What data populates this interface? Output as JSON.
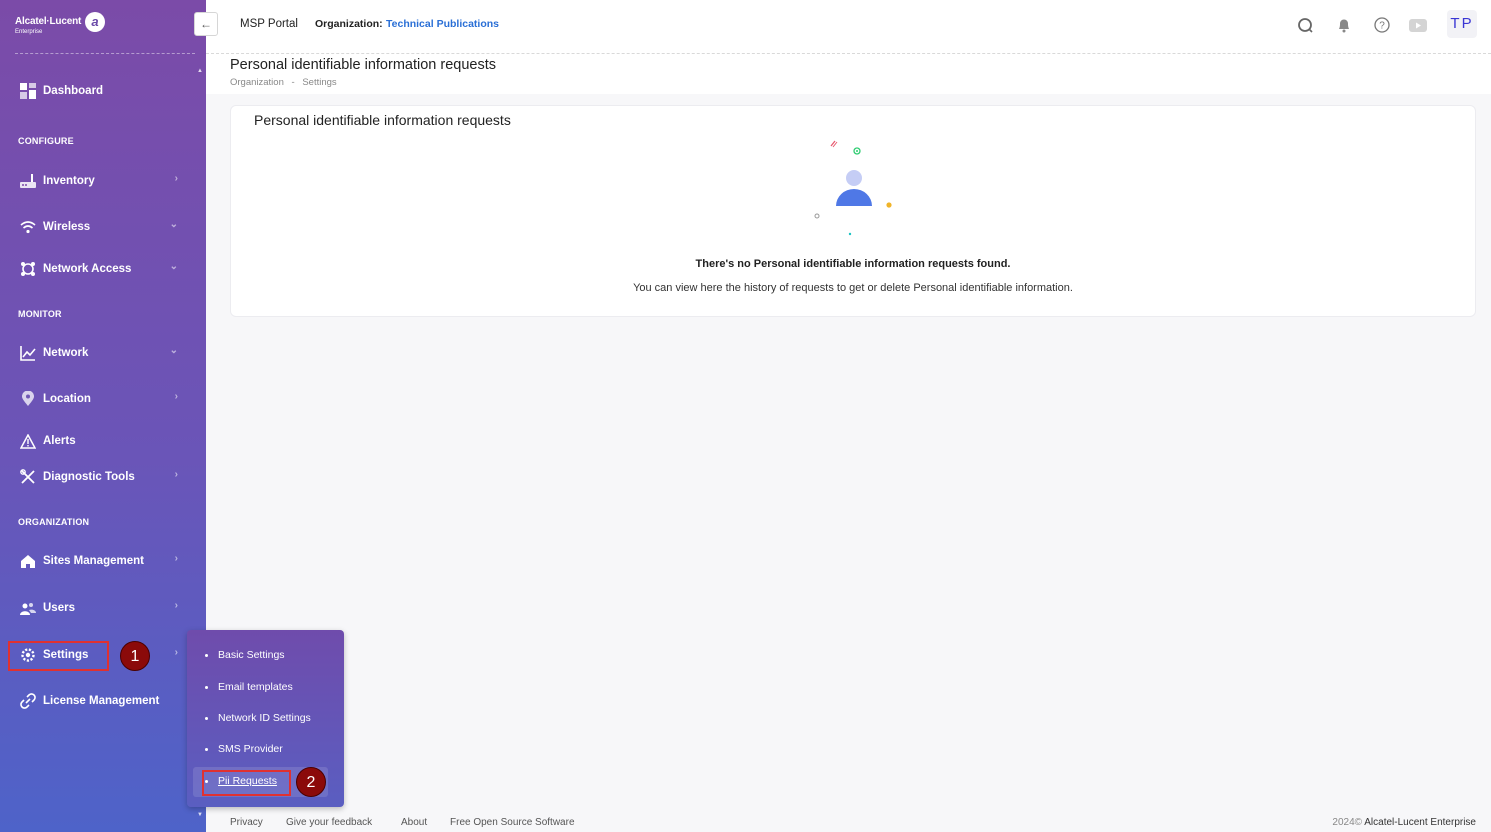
{
  "brand": {
    "name": "Alcatel·Lucent",
    "sub": "Enterprise"
  },
  "topbar": {
    "portal": "MSP Portal",
    "org_label": "Organization:",
    "org_value": "Technical Publications",
    "avatar": "TP",
    "collapse_glyph": "←"
  },
  "sidebar": {
    "dashboard": "Dashboard",
    "configure": "CONFIGURE",
    "inventory": "Inventory",
    "wireless": "Wireless",
    "network_access": "Network Access",
    "monitor": "MONITOR",
    "network": "Network",
    "location": "Location",
    "alerts": "Alerts",
    "diagnostic_tools": "Diagnostic Tools",
    "organization": "ORGANIZATION",
    "sites_management": "Sites Management",
    "users": "Users",
    "settings": "Settings",
    "license_management": "License Management"
  },
  "submenu": {
    "items": [
      "Basic Settings",
      "Email templates",
      "Network ID Settings",
      "SMS Provider",
      "Pii Requests"
    ],
    "active": "Pii Requests"
  },
  "annotations": {
    "step1": "1",
    "step2": "2",
    "color": "#8b0a0a"
  },
  "page": {
    "title": "Personal identifiable information requests",
    "breadcrumb": [
      "Organization",
      "-",
      "Settings"
    ]
  },
  "card": {
    "title": "Personal identifiable information requests",
    "empty_title": "There's no Personal identifiable information requests found.",
    "empty_sub": "You can view here the history of requests to get or delete Personal identifiable information."
  },
  "footer": {
    "links": [
      "Privacy",
      "Give your feedback",
      "About",
      "Free Open Source Software"
    ],
    "year": "2024©",
    "company": "Alcatel-Lucent Enterprise"
  }
}
